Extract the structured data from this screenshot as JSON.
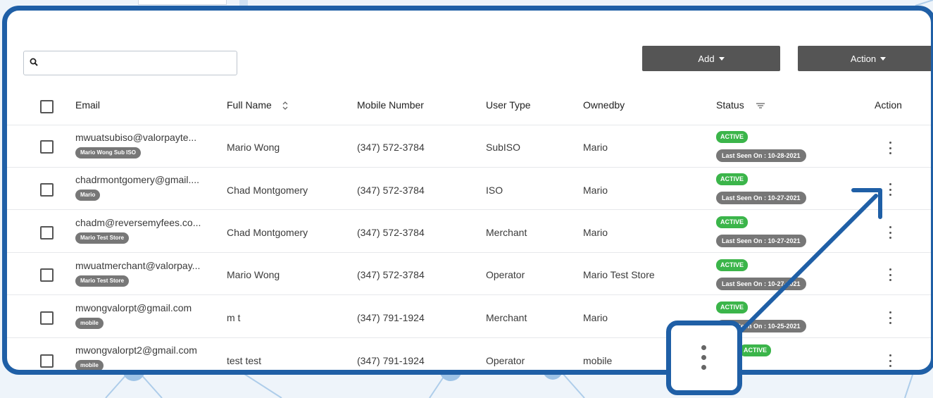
{
  "toolbar": {
    "search_placeholder": "",
    "add_label": "Add",
    "action_label": "Action"
  },
  "table": {
    "headers": {
      "email": "Email",
      "full_name": "Full Name",
      "mobile": "Mobile Number",
      "user_type": "User Type",
      "ownedby": "Ownedby",
      "status": "Status",
      "action": "Action"
    },
    "rows": [
      {
        "email": "mwuatsubiso@valorpayte...",
        "tag": "Mario Wong Sub ISO",
        "full_name": "Mario Wong",
        "mobile": "(347) 572-3784",
        "user_type": "SubISO",
        "ownedby": "Mario",
        "status": "ACTIVE",
        "last_seen": "Last Seen On : 10-28-2021"
      },
      {
        "email": "chadrmontgomery@gmail....",
        "tag": "Mario",
        "full_name": "Chad Montgomery",
        "mobile": "(347) 572-3784",
        "user_type": "ISO",
        "ownedby": "Mario",
        "status": "ACTIVE",
        "last_seen": "Last Seen On : 10-27-2021"
      },
      {
        "email": "chadm@reversemyfees.co...",
        "tag": "Mario Test Store",
        "full_name": "Chad Montgomery",
        "mobile": "(347) 572-3784",
        "user_type": "Merchant",
        "ownedby": "Mario",
        "status": "ACTIVE",
        "last_seen": "Last Seen On : 10-27-2021"
      },
      {
        "email": "mwuatmerchant@valorpay...",
        "tag": "Mario Test Store",
        "full_name": "Mario Wong",
        "mobile": "(347) 572-3784",
        "user_type": "Operator",
        "ownedby": "Mario Test Store",
        "status": "ACTIVE",
        "last_seen": "Last Seen On : 10-27-2021"
      },
      {
        "email": "mwongvalorpt@gmail.com",
        "tag": "mobile",
        "full_name": "m t",
        "mobile": "(347) 791-1924",
        "user_type": "Merchant",
        "ownedby": "Mario",
        "status": "ACTIVE",
        "last_seen": "Last Seen On : 10-25-2021"
      },
      {
        "email": "mwongvalorpt2@gmail.com",
        "tag": "mobile",
        "full_name": "test test",
        "mobile": "(347) 791-1924",
        "user_type": "Operator",
        "ownedby": "mobile",
        "status": "ACTIVE",
        "last_seen": ""
      }
    ]
  },
  "colors": {
    "frame": "#1f5fa6",
    "button": "#555555",
    "active": "#3bb54a",
    "pill": "#777777"
  },
  "icons": [
    "search-icon",
    "sort-icon",
    "filter-icon",
    "kebab-menu-icon",
    "caret-down-icon"
  ]
}
